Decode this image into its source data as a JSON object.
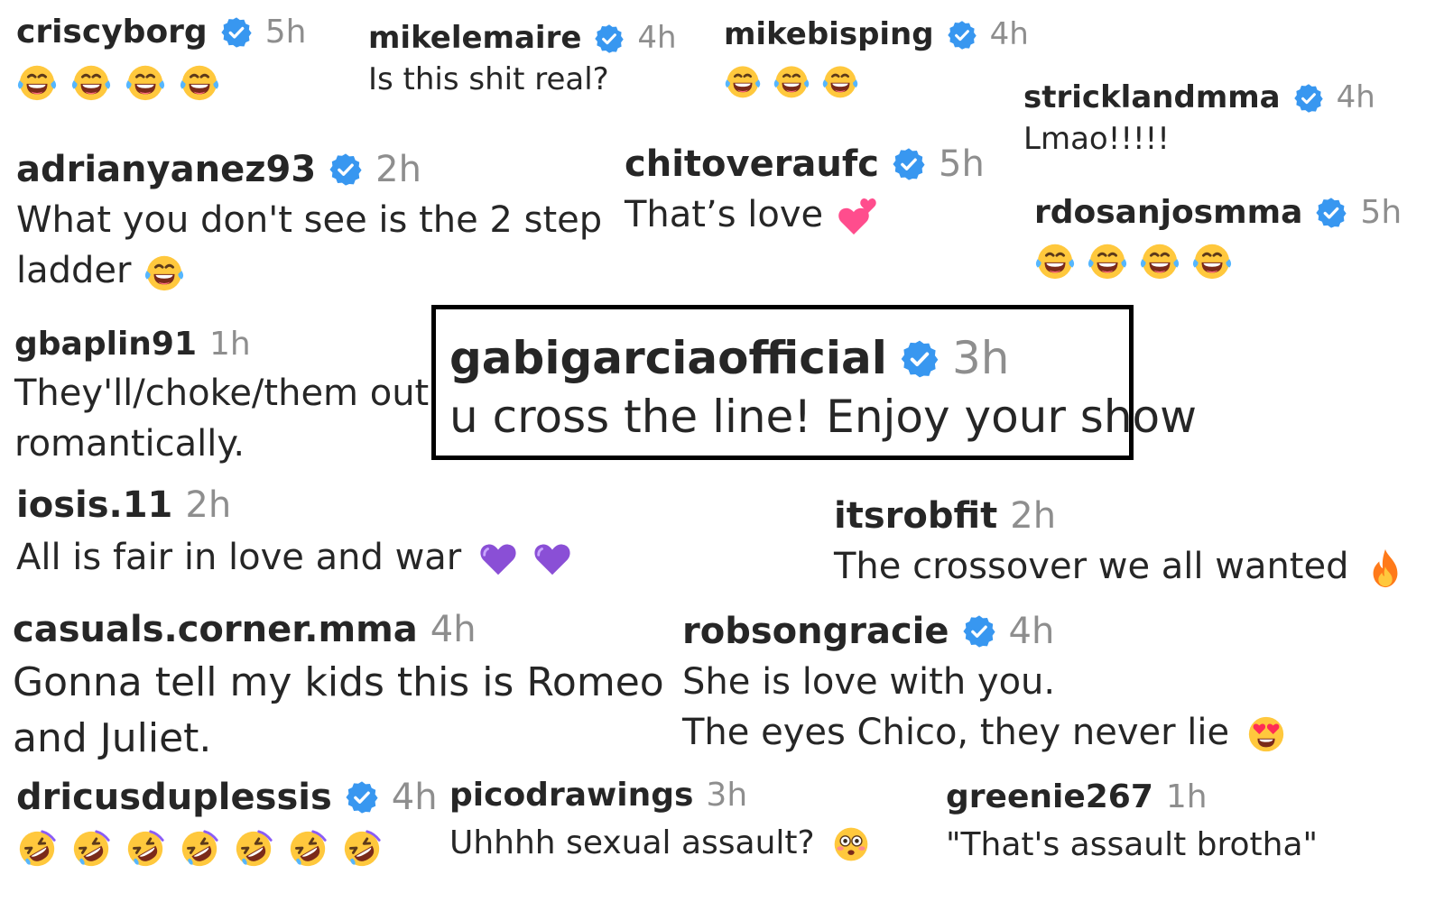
{
  "colors": {
    "verified_badge": "#3897f0",
    "username": "#262626",
    "timestamp": "#8e8e8e",
    "body_text": "#262626",
    "highlight_border": "#000000"
  },
  "comments": [
    {
      "id": "criscyborg",
      "username": "criscyborg",
      "verified": true,
      "time": "5h",
      "text": "",
      "emojis": [
        "laughing-tears-emoji",
        "laughing-tears-emoji",
        "laughing-tears-emoji",
        "laughing-tears-emoji"
      ]
    },
    {
      "id": "mikelemaire",
      "username": "mikelemaire",
      "verified": true,
      "time": "4h",
      "text": "Is this shit real?"
    },
    {
      "id": "mikebisping",
      "username": "mikebisping",
      "verified": true,
      "time": "4h",
      "text": "",
      "emojis": [
        "laughing-tears-emoji",
        "laughing-tears-emoji",
        "laughing-tears-emoji"
      ]
    },
    {
      "id": "stricklandmma",
      "username": "stricklandmma",
      "verified": true,
      "time": "4h",
      "text": "Lmao!!!!!"
    },
    {
      "id": "adrianyanez93",
      "username": "adrianyanez93",
      "verified": true,
      "time": "2h",
      "text_line1": "What you don't see is the 2 step",
      "text_line2": "ladder",
      "trailing_emoji": "laughing-tears-emoji"
    },
    {
      "id": "chitoveraufc",
      "username": "chitoveraufc",
      "verified": true,
      "time": "5h",
      "text": "That’s love",
      "trailing_emoji": "two-hearts-emoji"
    },
    {
      "id": "rdosanjosmma",
      "username": "rdosanjosmma",
      "verified": true,
      "time": "5h",
      "text": "",
      "emojis": [
        "laughing-tears-emoji",
        "laughing-tears-emoji",
        "laughing-tears-emoji",
        "laughing-tears-emoji"
      ]
    },
    {
      "id": "gbaplin91",
      "username": "gbaplin91",
      "verified": false,
      "time": "1h",
      "text_line1": "They'll/choke/them out",
      "text_line2": "romantically."
    },
    {
      "id": "gabigarciaofficial",
      "username": "gabigarciaofficial",
      "verified": true,
      "time": "3h",
      "text": "u cross the line! Enjoy your show",
      "highlighted": true
    },
    {
      "id": "iosis11",
      "username": "iosis.11",
      "verified": false,
      "time": "2h",
      "text": "All is fair in love and war",
      "trailing_emojis": [
        "purple-heart-emoji",
        "purple-heart-emoji"
      ]
    },
    {
      "id": "itsrobfit",
      "username": "itsrobfit",
      "verified": false,
      "time": "2h",
      "text": "The crossover we all wanted",
      "trailing_emoji": "fire-emoji"
    },
    {
      "id": "casualscornermma",
      "username": "casuals.corner.mma",
      "verified": false,
      "time": "4h",
      "text_line1": "Gonna tell my kids this is Romeo",
      "text_line2": "and Juliet."
    },
    {
      "id": "robsongracie",
      "username": "robsongracie",
      "verified": true,
      "time": "4h",
      "text_line1": "She is love with you.",
      "text_line2": "The eyes Chico, they never lie",
      "trailing_emoji": "heart-eyes-emoji"
    },
    {
      "id": "dricusduplessis",
      "username": "dricusduplessis",
      "verified": true,
      "time": "4h",
      "text": "",
      "emojis": [
        "rolling-laughing-emoji",
        "rolling-laughing-emoji",
        "rolling-laughing-emoji",
        "rolling-laughing-emoji",
        "rolling-laughing-emoji",
        "rolling-laughing-emoji",
        "rolling-laughing-emoji"
      ]
    },
    {
      "id": "picodrawings",
      "username": "picodrawings",
      "verified": false,
      "time": "3h",
      "text": "Uhhhh sexual assault?",
      "trailing_emoji": "flushed-emoji"
    },
    {
      "id": "greenie267",
      "username": "greenie267",
      "verified": false,
      "time": "1h",
      "text": "\"That's assault brotha\""
    }
  ]
}
